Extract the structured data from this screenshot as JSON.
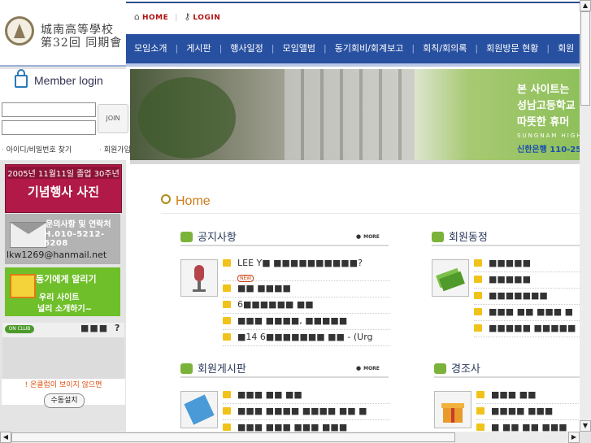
{
  "logo": {
    "line1": "城南高等學校",
    "line2": "第32回 同期會"
  },
  "toplinks": {
    "home": "HOME",
    "login": "LOGIN"
  },
  "nav": [
    "모임소개",
    "게시판",
    "행사일정",
    "모임앨범",
    "동기회비/회계보고",
    "회칙/회의록",
    "회원방문 현황",
    "회원"
  ],
  "login": {
    "title": "Member login",
    "join_button": "JOIN",
    "find_link": "아이디/비밀번호 찾기",
    "join_link": "회원가입"
  },
  "banners": {
    "event": {
      "line1": "2005년 11월11일 졸업 30주년",
      "line2": "기념행사 사진"
    },
    "contact": {
      "line1": "문의사항 및 연락처",
      "line2": "H.010-5212-6208",
      "email": "lkw1269@hanmail.net"
    },
    "notify": {
      "line1": "동기에게 알리기",
      "line2": "우리 사이트",
      "line3": "널리 소개하기~"
    }
  },
  "onclub": {
    "logo": "ON CLUB",
    "masked": "■■■",
    "help": "?"
  },
  "plugin": {
    "warning": "! 온클럽이 보이지 않으면",
    "button": "수동설치"
  },
  "hero": {
    "line1": "본 사이트는",
    "line2": "성남고등학교",
    "line3": "따뜻한 휴머",
    "line4": "SUNGNAM HIGHS",
    "line5": "신한은행 110-25"
  },
  "home_title": "Home",
  "sections": {
    "notice": {
      "title": "공지사항",
      "more": "MORE",
      "items": [
        "LEE Y■ ■■■■■■■■■■?",
        "■■ ■■■■",
        "6■■■■■■ ■■",
        "■■■ ■■■■, ■■■■■",
        "■14 6■■■■■■■ ■■ - (Urg"
      ],
      "new_badge": "NEW"
    },
    "members": {
      "title": "회원동정",
      "items": [
        "■■■■■",
        "■■■■■",
        "■■■■■■■",
        "■■■ ■■ ■■■ ■",
        "■■■■■ ■■■■■"
      ]
    },
    "board": {
      "title": "회원게시판",
      "more": "MORE",
      "items": [
        "■■■ ■■ ■■",
        "■■■ ■■■■ ■■■■ ■■ ■",
        "■■■ ■■■ ■■■ ■■■"
      ]
    },
    "condolence": {
      "title": "경조사",
      "items": [
        "■■■ ■■",
        "■■■■ ■■■",
        "■ ■■ ■■ ■■■"
      ]
    }
  },
  "colors": {
    "nav_bg": "#2850a0",
    "accent_red": "#b01010",
    "home_orange": "#d07a18",
    "section_green": "#7bb33a"
  }
}
